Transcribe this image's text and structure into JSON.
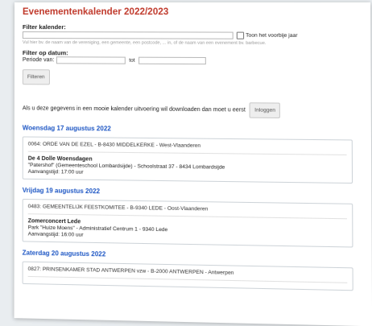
{
  "page_title": "Evenementenkalender 2022/2023",
  "filter_calendar": {
    "label": "Filter kalender:",
    "input_value": "",
    "checkbox_label": "Toon het voorbije jaar",
    "hint": "Vul hier bv. de naam van de vereniging, een gemeente, een postcode, ... in, of de naam van een evenement bv. barbecue."
  },
  "filter_date": {
    "label": "Filter op datum:",
    "period_label": "Periode van:",
    "from_value": "",
    "to_label": "tot",
    "to_value": ""
  },
  "filter_button": "Filteren",
  "download_info": "Als u deze gegevens in een mooie kalender uitvoering wil downloaden dan moet u eerst",
  "login_button": "Inloggen",
  "events": [
    {
      "date": "Woensdag 17 augustus 2022",
      "org": "0064: ORDE VAN DE EZEL - B-8430 MIDDELKERKE - West-Vlaanderen",
      "title": "De 4 Dolle Woensdagen",
      "location": "\"Patershof\" (Gemeenteschool Lombardsijde) - Schoolstraat 37 - 8434 Lombardsijde",
      "time": "Aanvangstijd: 17:00 uur"
    },
    {
      "date": "Vrijdag 19 augustus 2022",
      "org": "0483: GEMEENTELIJK FEESTKOMITEE - B-9340 LEDE - Oost-Vlaanderen",
      "title": "Zomerconcert Lede",
      "location": "Park \"Huize Moens\" - Administratief Centrum 1 - 9340 Lede",
      "time": "Aanvangstijd: 16:00 uur"
    },
    {
      "date": "Zaterdag 20 augustus 2022",
      "org": "0827: PRINSENKAMER STAD ANTWERPEN vzw - B-2000 ANTWERPEN - Antwerpen",
      "title": "",
      "location": "",
      "time": ""
    }
  ]
}
